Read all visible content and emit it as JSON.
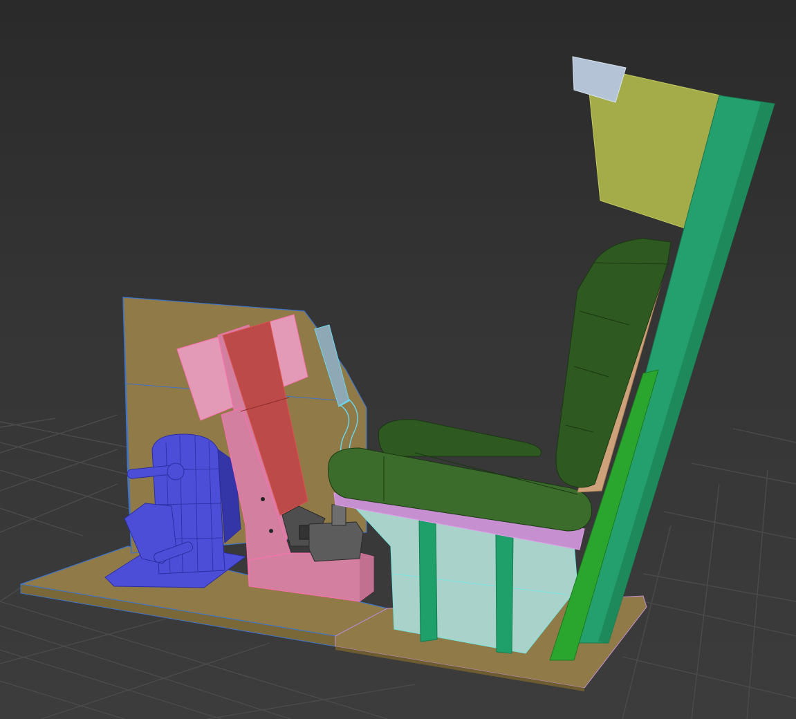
{
  "viewport": {
    "name": "perspective-viewport",
    "background": "#3a3a3a",
    "grid_color": "#4a4a4a"
  },
  "colors": {
    "floor": "#8f7a48",
    "wire_blue": "#3f74c9",
    "pedal": "#4c4ed8",
    "pedal_dark": "#3436a8",
    "stand": "#d37fa0",
    "stand_light": "#e39ab6",
    "stand_red": "#bb4a48",
    "stick": "#8fa8b6",
    "stick_wire": "#6ad7ef",
    "box": "#5c5c5c",
    "seat_base": "#a8d2ca",
    "seat_base_wire": "#78e6e0",
    "cushion": "#2e5a22",
    "cushion_light": "#3b6c2c",
    "pink_trim": "#c58fd0",
    "back_beige": "#cda27a",
    "frame_green": "#23a06e",
    "frame_green_dark": "#1e8a5c",
    "frame_lime": "#2aa52e",
    "headrest": "#a3ac48",
    "headrest_block": "#b4c4d6",
    "strut_green": "#1fa06a"
  }
}
